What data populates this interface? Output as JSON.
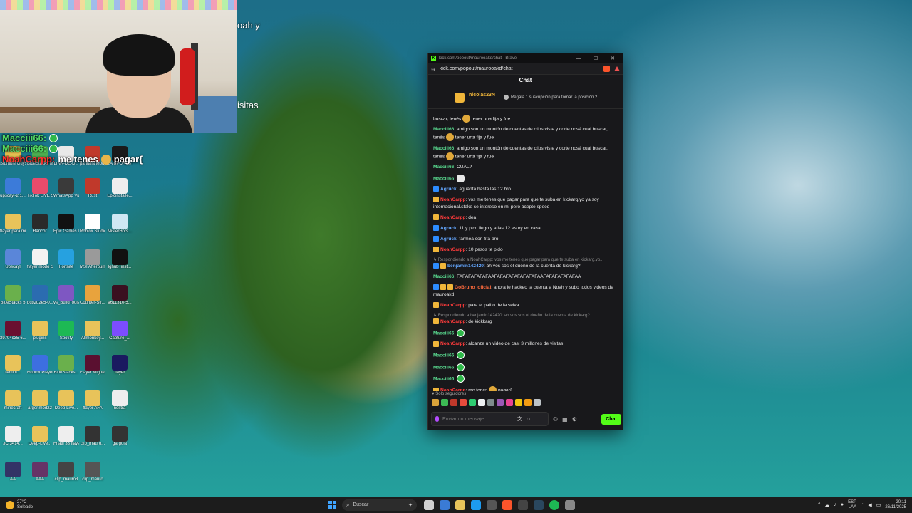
{
  "webcam_overlay": {
    "text_fragment_1": "oah y",
    "text_fragment_2": "isitas"
  },
  "overlay_chat": [
    {
      "user": "Macciii66:",
      "color": "#51d865",
      "emote": "green-k-badge"
    },
    {
      "user": "Macciii66:",
      "color": "#51d865",
      "emote": "green-k-badge"
    },
    {
      "user": "NoahCarpp:",
      "color": "#ff3030",
      "text_before": "me tenes",
      "text_after": "pagar{"
    }
  ],
  "desktop_icons": [
    {
      "label": "Stumble Guys",
      "color": "#e6c050"
    },
    {
      "label": "BlueStacks Multi-Insta",
      "color": "#4caf50"
    },
    {
      "label": "LINK-DE-D...",
      "color": "#e8e8e8"
    },
    {
      "label": "pantalla ModpackM...",
      "color": "#c0392b"
    },
    {
      "label": "EA SPORTS FC 26",
      "color": "#1a1a1a"
    },
    {
      "label": "upscayl-2.1...",
      "color": "#3c7bd9"
    },
    {
      "label": "TikTok LIVE Studio",
      "color": "#e94b6b"
    },
    {
      "label": "WhatsApp Video 2025...",
      "color": "#3a3a3a"
    },
    {
      "label": "Rust",
      "color": "#c0392b"
    },
    {
      "label": "Epicinstalle...",
      "color": "#eeeeee"
    },
    {
      "label": "flayer para miguel",
      "color": "#e8c35a"
    },
    {
      "label": "Bancor",
      "color": "#2a2a2a"
    },
    {
      "label": "Epic Games Launcher",
      "color": "#111111"
    },
    {
      "label": "Roblox Studio",
      "color": "#ffffff"
    },
    {
      "label": "MisterHors...",
      "color": "#cfe7f3"
    },
    {
      "label": "Upscayl",
      "color": "#5a86d9"
    },
    {
      "label": "flayer modo carrera",
      "color": "#f2f2f2"
    },
    {
      "label": "Fortnite",
      "color": "#26a1e0"
    },
    {
      "label": "MSI Afterburner",
      "color": "#9a9a9a"
    },
    {
      "label": "lghub_inst...",
      "color": "#111111"
    },
    {
      "label": "BlueStacks 5",
      "color": "#6ab04c"
    },
    {
      "label": "bcb2d2e5-0...",
      "color": "#2b6cb0"
    },
    {
      "label": "vs_BuildTools",
      "color": "#7e57c2"
    },
    {
      "label": "Counter-Str... 2",
      "color": "#e8a33d"
    },
    {
      "label": "a611310-5...",
      "color": "#3a1020"
    },
    {
      "label": "39704c35-6...",
      "color": "#6a1030"
    },
    {
      "label": "plugins",
      "color": "#e8c35a"
    },
    {
      "label": "Spotify",
      "color": "#1db954"
    },
    {
      "label": "Allmonkey...",
      "color": "#e8c35a"
    },
    {
      "label": "Capture_...",
      "color": "#7c4dff"
    },
    {
      "label": "remini...",
      "color": "#e8c35a"
    },
    {
      "label": "Roblox Player",
      "color": "#3d6fe0"
    },
    {
      "label": "BlueStacks...",
      "color": "#6ab04c"
    },
    {
      "label": "Flayer Miguel",
      "color": "#5a1030"
    },
    {
      "label": "flayer",
      "color": "#1a1a60"
    },
    {
      "label": "minecraft",
      "color": "#e8c35a"
    },
    {
      "label": "argenmod22",
      "color": "#e8c35a"
    },
    {
      "label": "Deep-Live...",
      "color": "#e8c35a"
    },
    {
      "label": "flayer AFA",
      "color": "#e8c35a"
    },
    {
      "label": "nostra",
      "color": "#eeeeee"
    },
    {
      "label": "3Cf3414...",
      "color": "#eeeeee"
    },
    {
      "label": "Deep-Live...",
      "color": "#e8c35a"
    },
    {
      "label": "Fnatil 33 flayer de...",
      "color": "#eeeeee"
    },
    {
      "label": "clip_mauro...",
      "color": "#333333"
    },
    {
      "label": "gargola",
      "color": "#333333"
    },
    {
      "label": "AA",
      "color": "#333366"
    },
    {
      "label": "AAA",
      "color": "#663366"
    },
    {
      "label": "clip_mauro3",
      "color": "#444444"
    },
    {
      "label": "clip_mauro",
      "color": "#555555"
    }
  ],
  "window": {
    "title": "kick.com/popout/maurooakd/chat - Brave",
    "url": "kick.com/popout/maurooakd/chat",
    "controls": [
      "—",
      "☐",
      "✕"
    ]
  },
  "chat": {
    "header": "Chat",
    "pinned": {
      "user": "nicolas23N",
      "count": "1",
      "gift_text": "Regala 1 suscripción para tomar la posición 2"
    },
    "messages": [
      {
        "user": "",
        "text": "buscar, tenés",
        "after": "tener una fija y fue",
        "emote": true,
        "partial": true
      },
      {
        "user": "Macciii66",
        "ucolor": "green",
        "text": "amigo son un montón de cuentas de clips viste y corte nosé cual buscar, tenés",
        "emote": true,
        "after": "tener una fija y fue"
      },
      {
        "user": "Macciii66",
        "ucolor": "green",
        "text": "amigo son un montón de cuentas de clips viste y corte nosé cual buscar, tenés",
        "emote": true,
        "after": "tener una fija y fue"
      },
      {
        "user": "Macciii66",
        "ucolor": "green",
        "text": "CUAL?"
      },
      {
        "user": "Macciii66",
        "ucolor": "green",
        "text": "",
        "ghost": true
      },
      {
        "user": "Agruck",
        "ucolor": "blue",
        "badge": "blue",
        "text": "aguanta hasta las 12 bro"
      },
      {
        "user": "NoahCarpp",
        "ucolor": "red",
        "badge": "crown",
        "text": "vos me tenes que pagar para que te suba en kickarg,yo ya soy internacional.stake se intereso en mi pero acepte speed"
      },
      {
        "user": "NoahCarpp",
        "ucolor": "red",
        "badge": "crown",
        "text": "dea"
      },
      {
        "user": "Agruck",
        "ucolor": "blue",
        "badge": "blue",
        "text": "11 y pico llego y a las 12 estoy en casa"
      },
      {
        "user": "Agruck",
        "ucolor": "blue",
        "badge": "blue",
        "text": "farmea con fifa bro"
      },
      {
        "user": "NoahCarpp",
        "ucolor": "red",
        "badge": "crown",
        "text": "10 pesos te pido"
      },
      {
        "reply": "Respondiendo a NoahCarpp: vos me tenes que pagar para que te suba en kickarg,yo...",
        "user": "benjamin142420",
        "ucolor": "blue",
        "badge": "blue2",
        "text": "ah vos sos el dueño de la cuenta de kickarg?"
      },
      {
        "user": "Macciii66",
        "ucolor": "green",
        "text": "FAFAFAFAFAFAAFAFAFAFAFAFAFAFAAFAFAFAFAFAFAA"
      },
      {
        "user": "GoBruno_oficial",
        "ucolor": "orange",
        "badge": "multi",
        "text": "ahora le hackeo la cuenta a Noah y subo todos videos de mauroakd"
      },
      {
        "user": "NoahCarpp",
        "ucolor": "red",
        "badge": "crown",
        "text": "para el palito de la selva"
      },
      {
        "reply": "Respondiendo a benjamin142420: ah vos sos el dueño de la cuenta de kickarg?",
        "user": "NoahCarpp",
        "ucolor": "red",
        "badge": "crown",
        "text": "de kickkarg"
      },
      {
        "user": "Macciii66",
        "ucolor": "green",
        "text": "",
        "kemote": true
      },
      {
        "user": "NoahCarpp",
        "ucolor": "red",
        "badge": "crown",
        "text": "alcanze un video de casi 3 millones de visitas"
      },
      {
        "user": "Macciii66",
        "ucolor": "green",
        "text": "",
        "kemote": true
      },
      {
        "user": "Macciii66",
        "ucolor": "green",
        "text": "",
        "kemote": true
      },
      {
        "user": "Macciii66",
        "ucolor": "green",
        "text": "",
        "kemote": true
      },
      {
        "user": "NoahCarpp",
        "ucolor": "red",
        "badge": "crown",
        "text": "me tenes",
        "emote": true,
        "after": "pagar{"
      }
    ],
    "followers_only": "Solo seguidores",
    "input_placeholder": "Enviar un mensaje",
    "send_label": "Chat"
  },
  "taskbar": {
    "temperature": "27°C",
    "weather": "Soleado",
    "search_label": "Buscar",
    "language": "ESP",
    "layout": "LAA",
    "time": "20:11",
    "date": "26/11/2025"
  },
  "colors": {
    "kick_green": "#53fc18",
    "chat_bg": "#18181b"
  }
}
